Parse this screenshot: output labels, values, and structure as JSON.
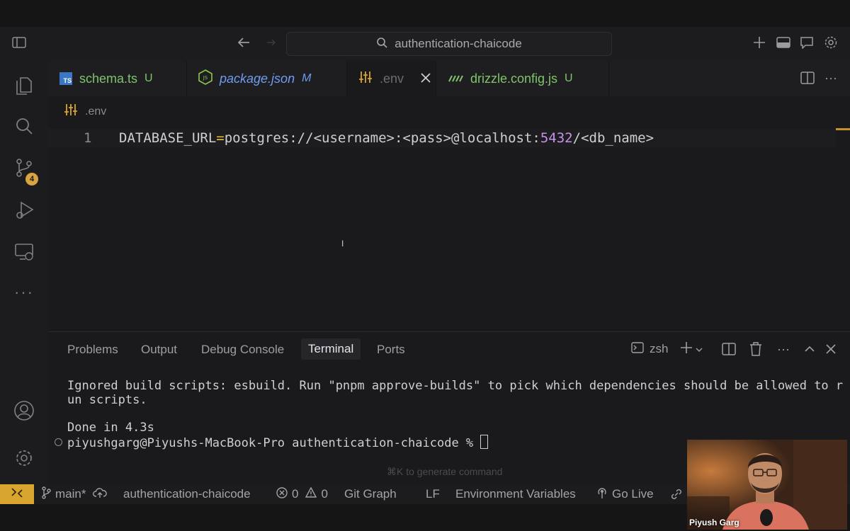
{
  "titlebar": {
    "search_text": "authentication-chaicode"
  },
  "activity": {
    "scm_badge": "4"
  },
  "tabs": [
    {
      "name": "schema.ts",
      "status": "U",
      "icon": "typescript-icon",
      "color": "#7fc46b"
    },
    {
      "name": "package.json",
      "status": "M",
      "icon": "nodejs-icon",
      "color": "#6f9cf2"
    },
    {
      "name": ".env",
      "status": "",
      "icon": "env-settings-icon",
      "color": "#6b6b70"
    },
    {
      "name": "drizzle.config.js",
      "status": "U",
      "icon": "drizzle-icon",
      "color": "#7fc46b"
    }
  ],
  "editor": {
    "breadcrumb": ".env",
    "line_number": "1",
    "code_key": "DATABASE_URL",
    "code_eq": "=",
    "code_val1": "postgres://<username>:<pass>@localhost:",
    "code_port": "5432",
    "code_val2": "/<db_name>"
  },
  "panel": {
    "tabs": [
      "Problems",
      "Output",
      "Debug Console",
      "Terminal",
      "Ports"
    ],
    "shell": "zsh",
    "lines": [
      "Ignored build scripts: esbuild. Run \"pnpm approve-builds\" to pick which dependencies should be allowed to r",
      "un scripts.",
      "Done in 4.3s",
      "piyushgarg@Piyushs-MacBook-Pro authentication-chaicode % "
    ],
    "hint": "⌘K to generate command"
  },
  "statusbar": {
    "branch": "main*",
    "folder": "authentication-chaicode",
    "errors": "0",
    "warnings": "0",
    "git_graph": "Git Graph",
    "eol": "LF",
    "env_vars": "Environment Variables",
    "go_live": "Go Live"
  },
  "webcam": {
    "name": "Piyush Garg"
  },
  "colors": {
    "accent": "#d8a62e",
    "added": "#7fc46b",
    "modified": "#6f9cf2",
    "operator": "#e8bf3a",
    "number": "#c792ea"
  }
}
